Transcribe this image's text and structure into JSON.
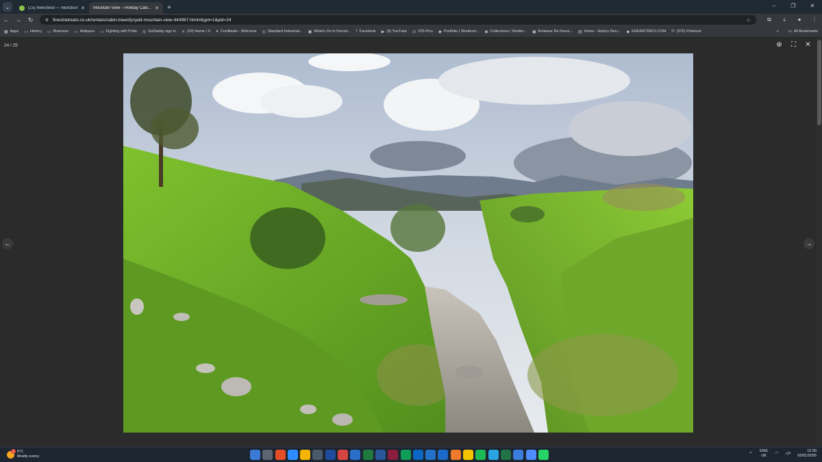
{
  "browser": {
    "tabs": [
      {
        "title": "(15) Newsfeed — Nextdoor",
        "active": false
      },
      {
        "title": "Mountain View – Holiday Cabi...",
        "active": true
      }
    ],
    "new_tab_symbol": "+",
    "window_controls": [
      "–",
      "❐",
      "✕"
    ],
    "url": "finestretreats.co.uk/rentals/cabin-trawsfynydd-mountain-view-444967.html#&gid=1&pid=24",
    "bookmarks": [
      "Apps",
      "History",
      "Business",
      "Antiques",
      "Fighting with Pride",
      "GoDaddy sign in",
      "(20) Home / X",
      "Creditsafe - Welcome",
      "Standard Industrial...",
      "What's On in Dorset...",
      "Facebook",
      "(9) YouTube",
      "225-Pics",
      "Portfolio | Shutterst...",
      "Collections | Shutter...",
      "Knitwear Re Dress...",
      "Home - History Reci...",
      "ENDARTINFO.COM",
      "(575) Pinterest"
    ],
    "bookmarks_overflow": "»",
    "all_bookmarks": "All Bookmarks"
  },
  "viewer": {
    "counter": "24 / 25",
    "zoom_icon": "search-plus-icon",
    "fullscreen_icon": "fullscreen-icon",
    "close_icon": "close-icon",
    "prev_symbol": "←",
    "next_symbol": "→",
    "photo_subject": "Mountain valley with stream, green hills and cloudy sky"
  },
  "taskbar": {
    "weather_temp": "5°C",
    "weather_desc": "Mostly sunny",
    "weather_badge": "1",
    "language": "ENG",
    "region": "UK",
    "time": "12:30",
    "date": "02/01/2025",
    "tray_overflow": "^",
    "app_colors": [
      "#3a7bd5",
      "#5b6470",
      "#e44d26",
      "#2d8cff",
      "#f4b400",
      "#4a5a6a",
      "#1e4b9e",
      "#d64541",
      "#2a6fc9",
      "#1f7a3f",
      "#2b579a",
      "#8b1e3f",
      "#0f9d58",
      "#0a66c2",
      "#2372c7",
      "#1b6ac9",
      "#f07a2b",
      "#f5c400",
      "#1db954",
      "#2aa4e0",
      "#217346",
      "#3b7ddd",
      "#4e8cff",
      "#25d366"
    ]
  },
  "colors": {
    "chrome_dark": "#1f2a33",
    "toolbar": "#35393d",
    "viewer_bg": "#2b2b2b",
    "taskbar": "#1c2530"
  }
}
